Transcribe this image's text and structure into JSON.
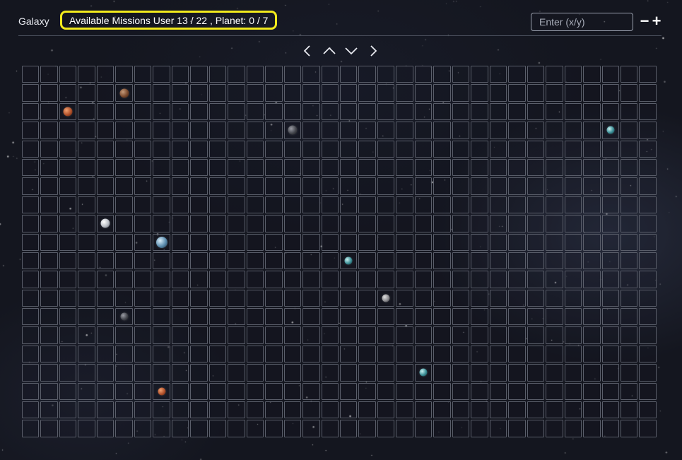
{
  "header": {
    "title": "Galaxy",
    "missions_text": "Available Missions User 13 / 22 , Planet: 0 / 7"
  },
  "search": {
    "placeholder": "Enter (x/y)",
    "value": ""
  },
  "zoom": {
    "out_label": "−",
    "in_label": "+"
  },
  "navigation": [
    "left",
    "up",
    "down",
    "right"
  ],
  "grid": {
    "columns": 34,
    "rows": 20
  },
  "planets": [
    {
      "row": 2,
      "col": 6,
      "type": "brown",
      "size": "md"
    },
    {
      "row": 3,
      "col": 3,
      "type": "orange",
      "size": "md"
    },
    {
      "row": 4,
      "col": 15,
      "type": "dark",
      "size": "md"
    },
    {
      "row": 4,
      "col": 32,
      "type": "teal",
      "size": "sm"
    },
    {
      "row": 9,
      "col": 5,
      "type": "white",
      "size": "md"
    },
    {
      "row": 10,
      "col": 8,
      "type": "blue",
      "size": "lg"
    },
    {
      "row": 11,
      "col": 18,
      "type": "teal",
      "size": "sm"
    },
    {
      "row": 13,
      "col": 20,
      "type": "gray",
      "size": "sm"
    },
    {
      "row": 14,
      "col": 6,
      "type": "dark",
      "size": "sm"
    },
    {
      "row": 17,
      "col": 22,
      "type": "teal",
      "size": "sm"
    },
    {
      "row": 18,
      "col": 8,
      "type": "orange",
      "size": "sm"
    }
  ],
  "colors": {
    "highlight": "#f2ea1c",
    "grid_line": "#5a5e6a",
    "background": "#14161f"
  }
}
